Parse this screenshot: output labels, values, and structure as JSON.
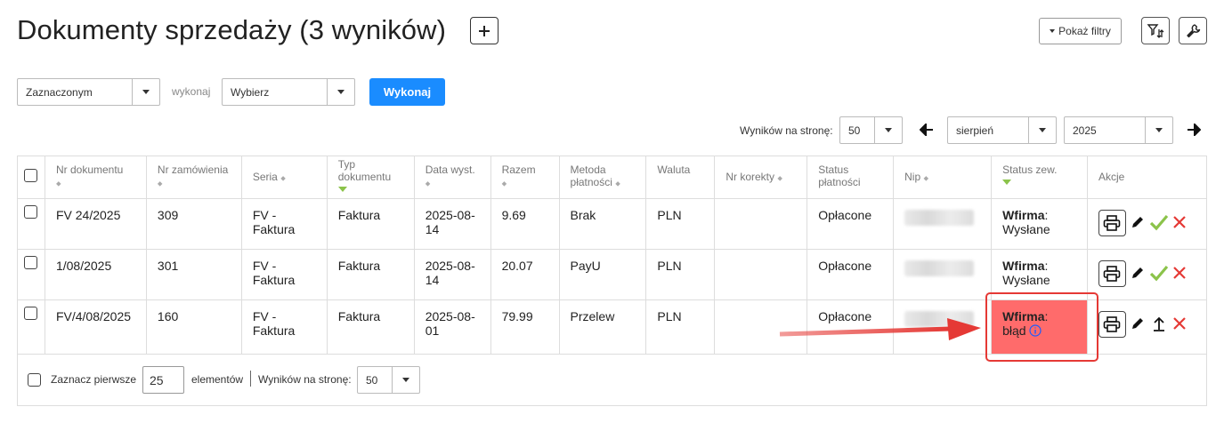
{
  "page": {
    "title": "Dokumenty sprzedaży (3 wyników)"
  },
  "header": {
    "filters_label": "Pokaż filtry"
  },
  "bulk": {
    "scope_value": "Zaznaczonym",
    "action_prefix": "wykonaj",
    "action_value": "Wybierz",
    "execute_label": "Wykonaj"
  },
  "pager": {
    "per_page_label": "Wyników na stronę:",
    "per_page_value": "50",
    "month_value": "sierpień",
    "year_value": "2025"
  },
  "table": {
    "columns": {
      "nr": "Nr dokumentu",
      "order": "Nr zamówienia",
      "seria": "Seria",
      "typ": "Typ dokumentu",
      "data": "Data wyst.",
      "razem": "Razem",
      "metoda": "Metoda płatności",
      "waluta": "Waluta",
      "korekty": "Nr korekty",
      "status": "Status płatności",
      "nip": "Nip",
      "statuszew": "Status zew.",
      "akcje": "Akcje"
    },
    "rows": [
      {
        "nr": "FV 24/2025",
        "order": "309",
        "seria": "FV - Faktura",
        "typ": "Faktura",
        "data": "2025-08-14",
        "razem": "9.69",
        "metoda": "Brak",
        "waluta": "PLN",
        "korekty": "",
        "status": "Opłacone",
        "ext_name": "Wfirma",
        "ext_sep": ":",
        "ext_state": "Wysłane"
      },
      {
        "nr": "1/08/2025",
        "order": "301",
        "seria": "FV - Faktura",
        "typ": "Faktura",
        "data": "2025-08-14",
        "razem": "20.07",
        "metoda": "PayU",
        "waluta": "PLN",
        "korekty": "",
        "status": "Opłacone",
        "ext_name": "Wfirma",
        "ext_sep": ":",
        "ext_state": "Wysłane"
      },
      {
        "nr": "FV/4/08/2025",
        "order": "160",
        "seria": "FV - Faktura",
        "typ": "Faktura",
        "data": "2025-08-01",
        "razem": "79.99",
        "metoda": "Przelew",
        "waluta": "PLN",
        "korekty": "",
        "status": "Opłacone",
        "ext_name": "Wfirma",
        "ext_sep": ":",
        "ext_state": "błąd"
      }
    ]
  },
  "footer": {
    "select_first_label": "Zaznacz pierwsze",
    "select_first_value": "25",
    "elements_label": "elementów",
    "per_page_label": "Wyników na stronę:",
    "per_page_value": "50"
  },
  "colors": {
    "primary": "#1a8cff",
    "error_bg": "#ff6b6b",
    "error_border": "#e53935",
    "check": "#8bc34a",
    "delete": "#e53935"
  }
}
